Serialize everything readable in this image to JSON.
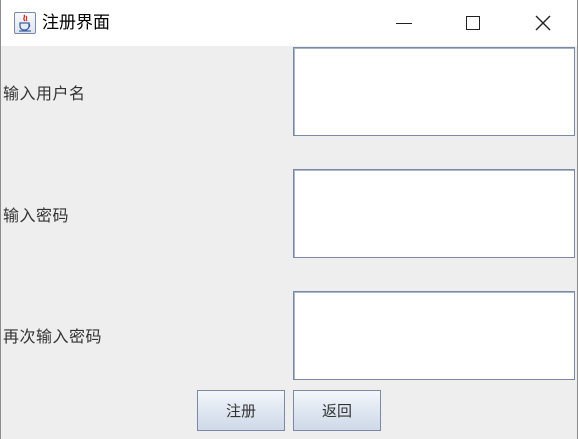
{
  "window": {
    "title": "注册界面",
    "icon": "java-app-icon",
    "controls": [
      "minimize-icon",
      "maximize-icon",
      "close-icon"
    ]
  },
  "form": {
    "username_label": "输入用户名",
    "username_value": "",
    "password_label": "输入密码",
    "password_value": "",
    "confirm_label": "再次输入密码",
    "confirm_value": ""
  },
  "buttons": {
    "register": "注册",
    "back": "返回"
  }
}
